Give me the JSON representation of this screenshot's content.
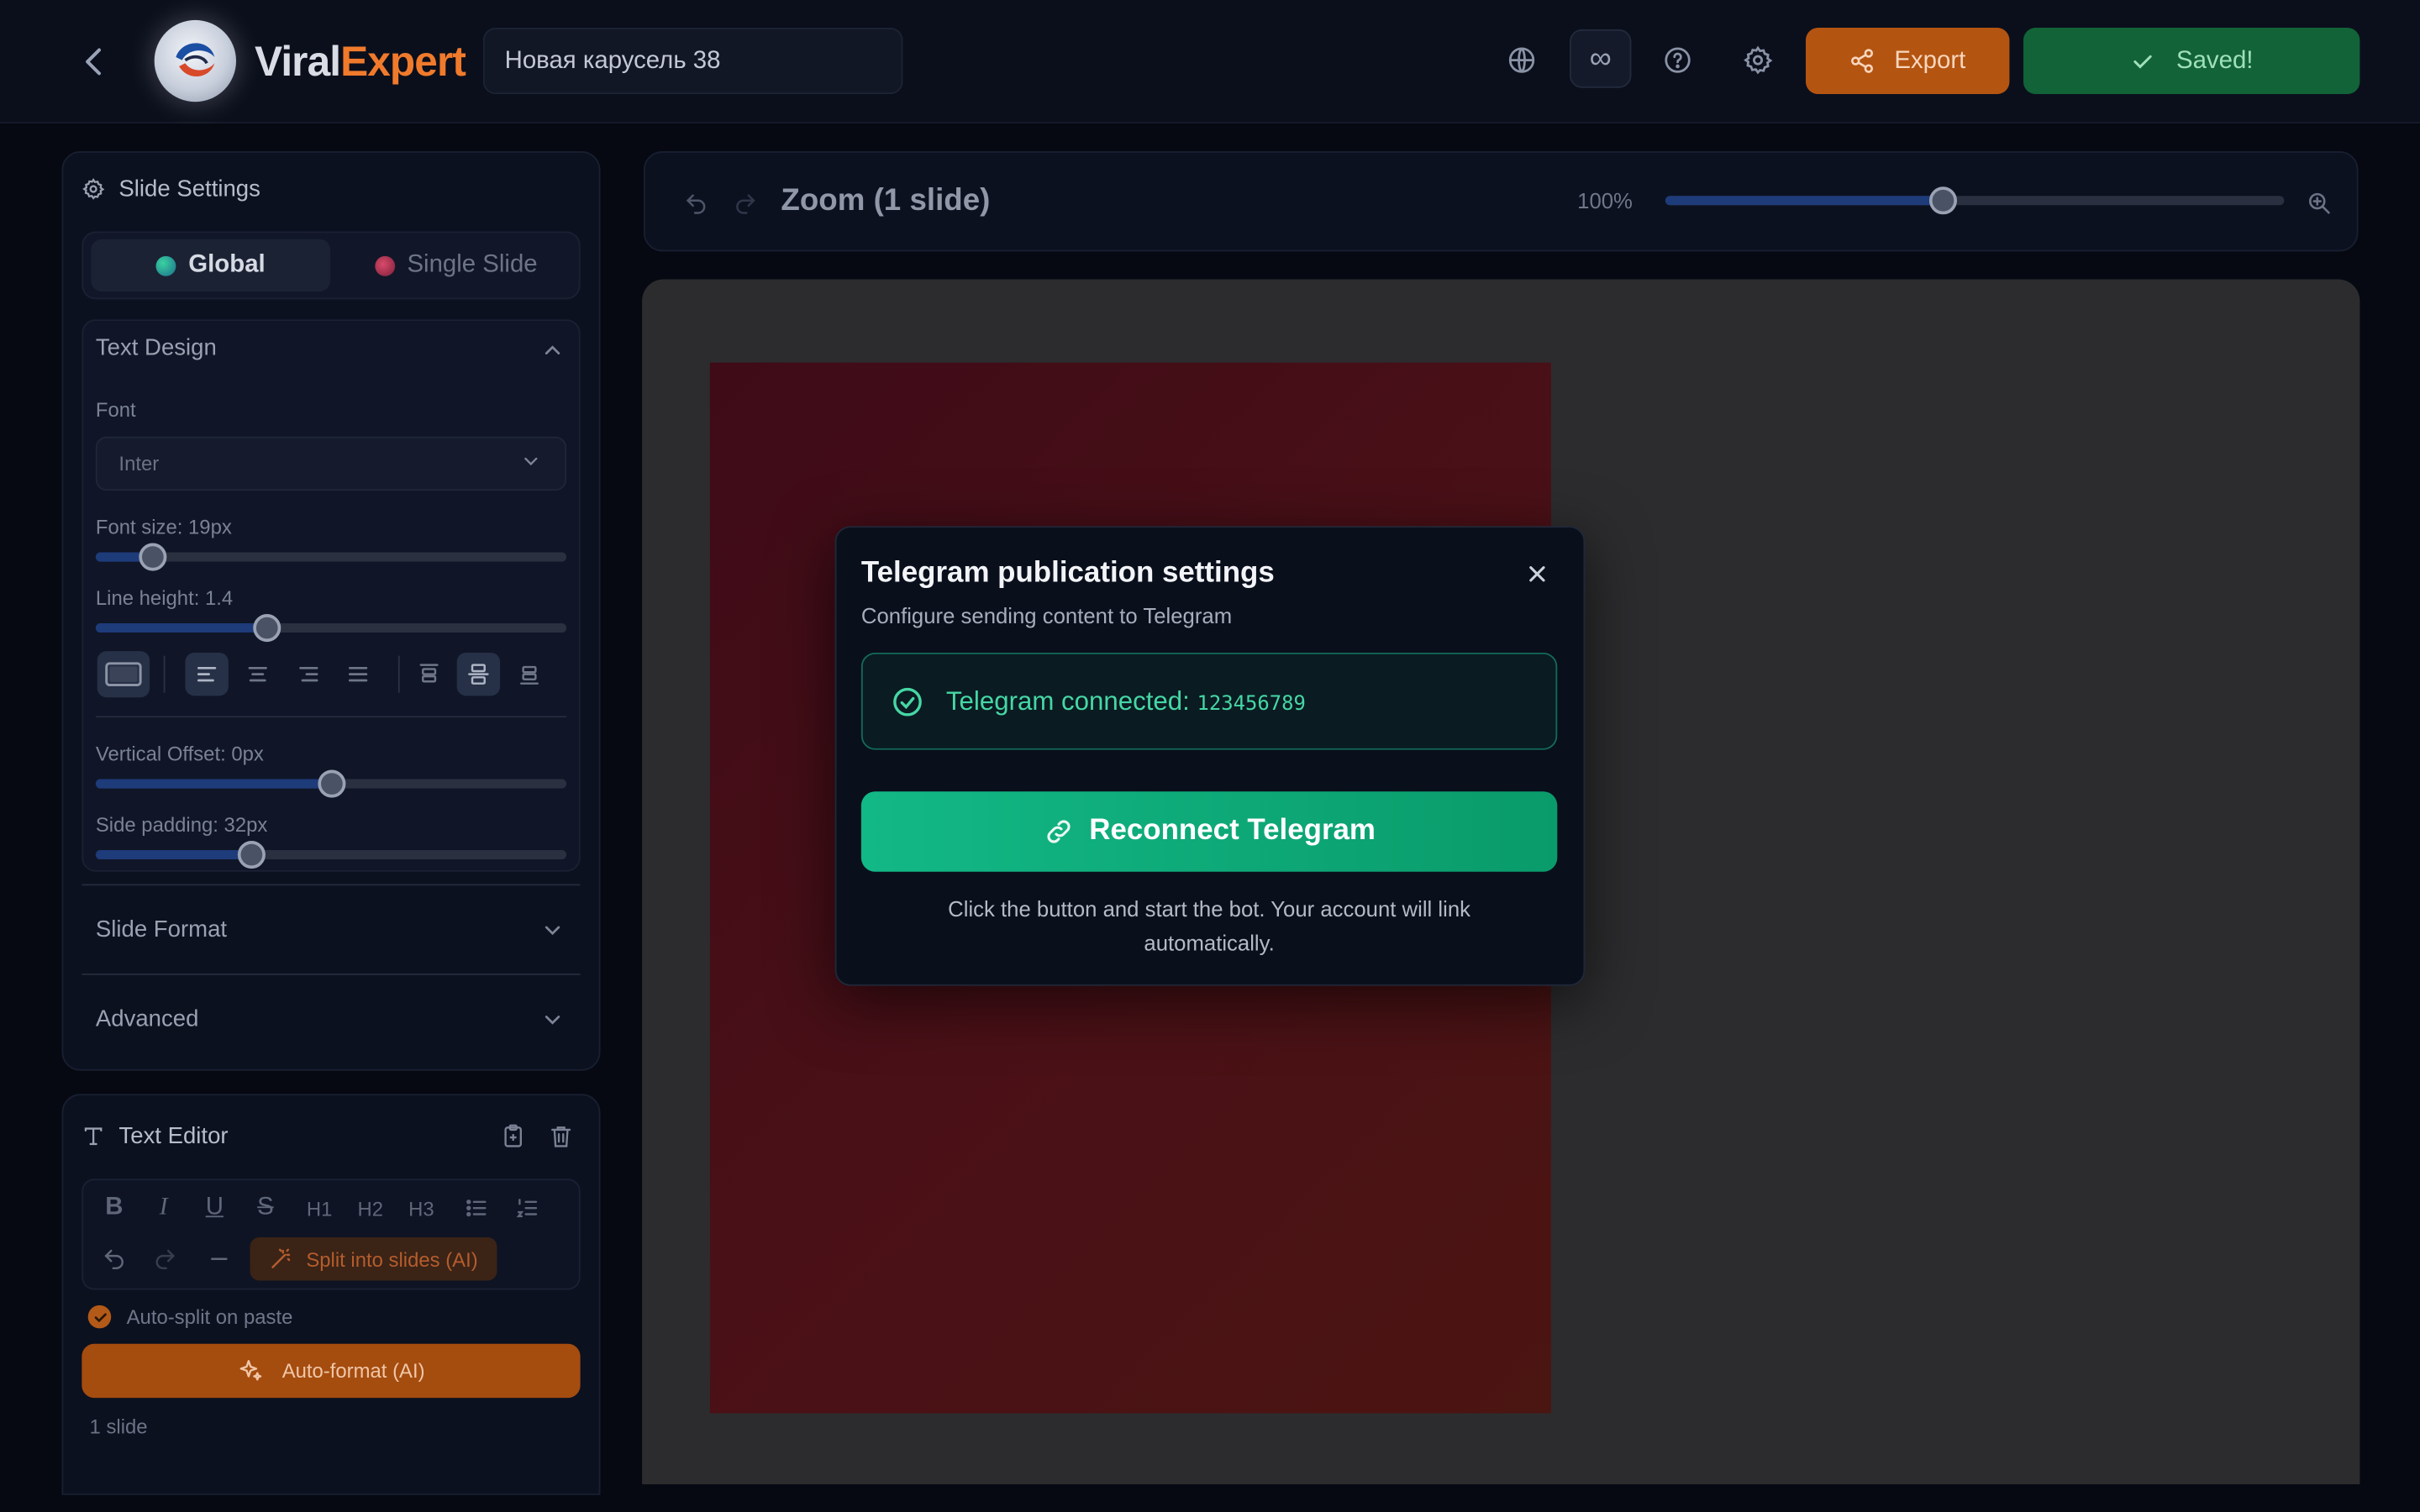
{
  "header": {
    "logo_viral": "Viral",
    "logo_expert": "Expert",
    "project_title": "Новая карусель 38",
    "infinity_label": "∞",
    "export_label": "Export",
    "saved_label": "Saved!"
  },
  "slide_settings": {
    "title": "Slide Settings",
    "tabs": [
      {
        "label": "Global",
        "active": true
      },
      {
        "label": "Single Slide",
        "active": false
      }
    ],
    "text_design": {
      "title": "Text Design",
      "font_label": "Font",
      "font_value": "Inter",
      "font_size_label": "Font size: 19px",
      "font_size_fraction": 0.12,
      "line_height_label": "Line height: 1.4",
      "line_height_fraction": 0.365,
      "vertical_offset_label": "Vertical Offset: 0px",
      "vertical_offset_fraction": 0.5,
      "side_padding_label": "Side padding: 32px",
      "side_padding_fraction": 0.33
    },
    "sections": [
      {
        "title": "Slide Format"
      },
      {
        "title": "Advanced"
      }
    ]
  },
  "text_editor": {
    "title": "Text Editor",
    "toolbar": [
      "B",
      "I",
      "U",
      "S",
      "H1",
      "H2",
      "H3"
    ],
    "split_label": "Split into slides (AI)",
    "autosplit_label": "Auto-split on paste",
    "autoformat_label": "Auto-format (AI)",
    "slide_count": "1 slide"
  },
  "zoom": {
    "title": "Zoom (1 slide)",
    "level": "100%",
    "slider_fraction": 0.45
  },
  "modal": {
    "title": "Telegram publication settings",
    "subtitle": "Configure sending content to Telegram",
    "connected_label": "Telegram connected:",
    "connected_id": "123456789",
    "reconnect_label": "Reconnect Telegram",
    "help_text": "Click the button and start the bot. Your account will link automatically."
  },
  "colors": {
    "accent_orange": "#f07a2c",
    "success_green": "#12b886",
    "saved_green": "#126338"
  }
}
